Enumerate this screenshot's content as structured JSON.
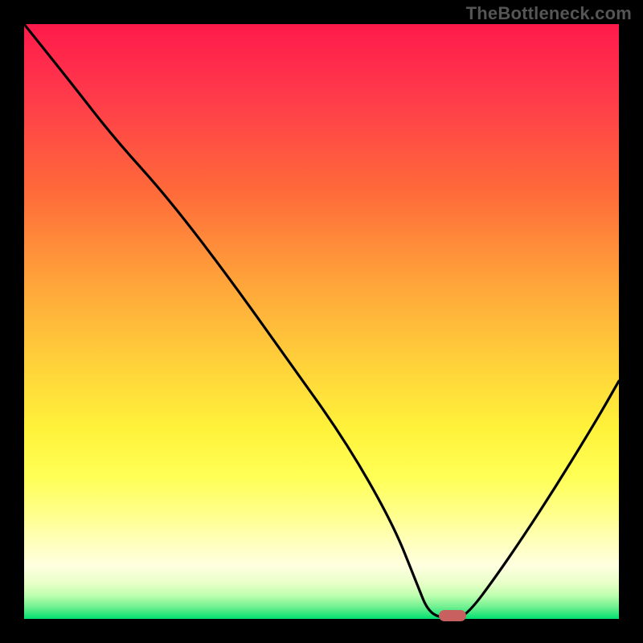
{
  "watermark": "TheBottleneck.com",
  "colors": {
    "frame_bg": "#000000",
    "curve": "#000000",
    "marker": "#c86060",
    "gradient_top": "#ff1a4b",
    "gradient_bottom": "#00e070"
  },
  "chart_data": {
    "type": "line",
    "title": "",
    "xlabel": "",
    "ylabel": "",
    "xlim": [
      0,
      100
    ],
    "ylim": [
      0,
      100
    ],
    "grid": false,
    "legend": false,
    "series": [
      {
        "name": "bottleneck-curve",
        "x": [
          0,
          8,
          15,
          24,
          34,
          44,
          54,
          62,
          66,
          68,
          71,
          74,
          80,
          88,
          96,
          100
        ],
        "values": [
          100,
          90,
          81,
          71,
          58,
          44,
          30,
          16,
          6,
          1,
          0,
          0,
          8,
          20,
          33,
          40
        ]
      }
    ],
    "marker": {
      "x": 72,
      "y": 0
    },
    "background_gradient": {
      "type": "vertical",
      "stops": [
        {
          "pos": 0,
          "color": "#ff1a4b"
        },
        {
          "pos": 44,
          "color": "#ffa63a"
        },
        {
          "pos": 76,
          "color": "#ffff55"
        },
        {
          "pos": 100,
          "color": "#00e070"
        }
      ]
    }
  }
}
